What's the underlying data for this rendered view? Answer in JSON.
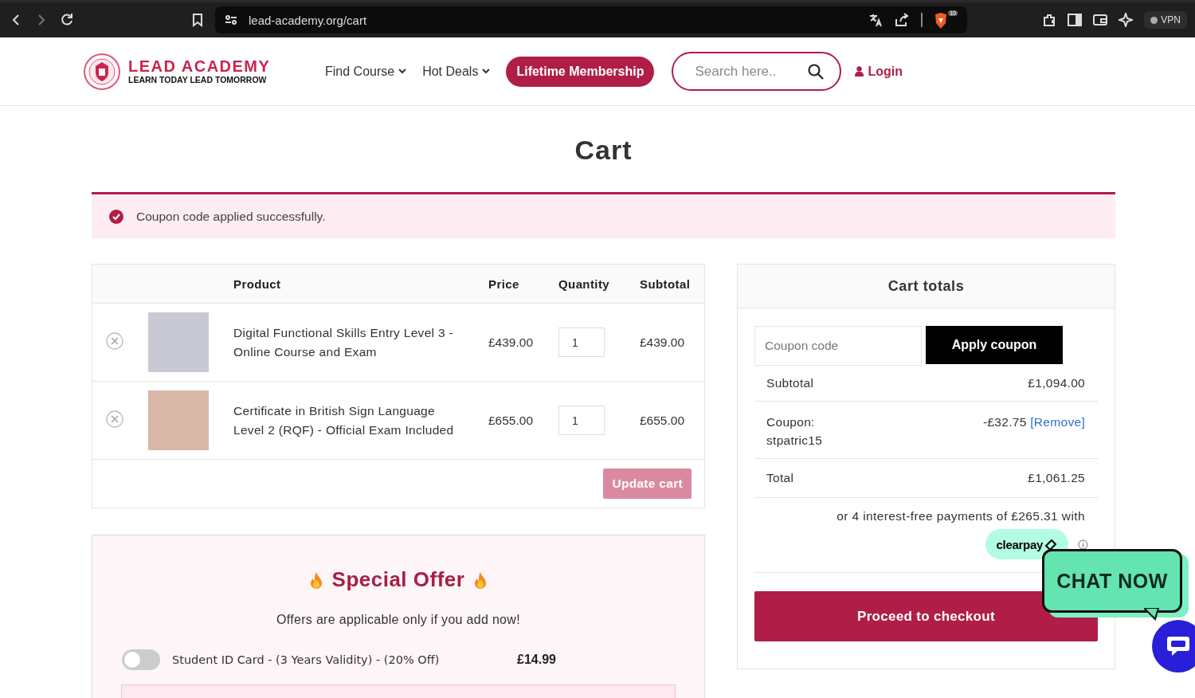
{
  "browser": {
    "url": "lead-academy.org/cart",
    "shield_count": "10",
    "vpn": "VPN"
  },
  "header": {
    "logo_title": "LEAD ACADEMY",
    "logo_tagline": "LEARN TODAY LEAD TOMORROW",
    "nav": [
      {
        "label": "Find Course",
        "kind": "dropdown"
      },
      {
        "label": "Hot Deals",
        "kind": "dropdown"
      },
      {
        "label": "Lifetime Membership",
        "kind": "pill"
      }
    ],
    "search": {
      "placeholder": "Search here.."
    },
    "login": "Login"
  },
  "page_title": "Cart",
  "notice": {
    "text": "Coupon code applied successfully."
  },
  "cart_table": {
    "columns": [
      "Product",
      "Price",
      "Quantity",
      "Subtotal"
    ],
    "rows": [
      {
        "product": "Digital Functional Skills Entry Level 3 - Online Course and Exam",
        "price": "£439.00",
        "quantity": "1",
        "subtotal": "£439.00"
      },
      {
        "product": "Certificate in British Sign Language Level 2 (RQF) - Official Exam Included",
        "price": "£655.00",
        "quantity": "1",
        "subtotal": "£655.00"
      }
    ],
    "update_button": {
      "label": "Update cart",
      "disabled": true
    }
  },
  "cart_totals": {
    "title": "Cart totals",
    "coupon_placeholder": "Coupon code",
    "apply_label": "Apply coupon",
    "subtotal": {
      "label": "Subtotal",
      "value": "£1,094.00"
    },
    "coupon": {
      "label": "Coupon:",
      "code": "stpatric15",
      "value": "-£32.75",
      "link": "[Remove]"
    },
    "total": {
      "label": "Total",
      "value": "£1,061.25"
    },
    "installments": "or 4 interest-free payments of £265.31 with",
    "clearpay": "clearpay",
    "checkout_label": "Proceed to checkout"
  },
  "special_offer": {
    "title": "Special Offer",
    "subtitle": "Offers are applicable only if you add now!",
    "items": [
      {
        "label": "Student ID Card - (3 Years Validity) - (20% Off)",
        "price": "£14.99",
        "on": false
      }
    ]
  },
  "chat": {
    "label": "CHAT NOW"
  }
}
